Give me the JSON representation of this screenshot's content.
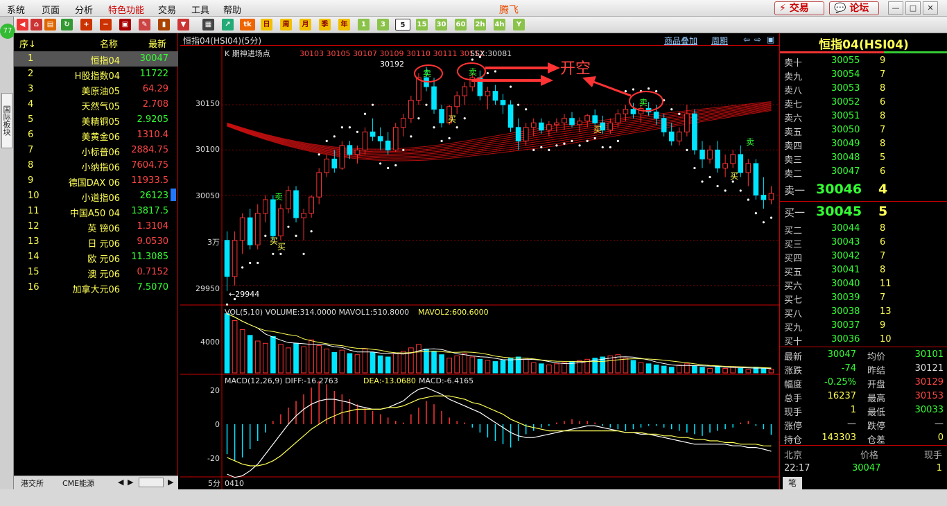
{
  "menu": {
    "items": [
      "系统",
      "页面",
      "分析",
      "特色功能",
      "交易",
      "工具",
      "帮助"
    ],
    "app_title": "腾飞",
    "trade_btn": "交易",
    "forum_btn": "论坛"
  },
  "toolbar": {
    "periods": [
      "日",
      "周",
      "月",
      "季",
      "年",
      "1",
      "3",
      "5",
      "15",
      "30",
      "60",
      "2h",
      "4h",
      "Y"
    ],
    "active_period": "5"
  },
  "left_strip": {
    "badge": "77",
    "vtab": "国际板块"
  },
  "watchlist": {
    "headers": {
      "index": "序↓",
      "name": "名称",
      "latest": "最新"
    },
    "rows": [
      {
        "idx": "1",
        "name": "恒指04",
        "price": "30047",
        "color": "#3f3",
        "selected": true
      },
      {
        "idx": "2",
        "name": "H股指数04",
        "price": "11722",
        "color": "#3f3"
      },
      {
        "idx": "3",
        "name": "美原油05",
        "price": "64.29",
        "color": "#f44"
      },
      {
        "idx": "4",
        "name": "天然气05",
        "price": "2.708",
        "color": "#f44"
      },
      {
        "idx": "5",
        "name": "美精铜05",
        "price": "2.9205",
        "color": "#3f3"
      },
      {
        "idx": "6",
        "name": "美黄金06",
        "price": "1310.4",
        "color": "#f44"
      },
      {
        "idx": "7",
        "name": "小标普06",
        "price": "2884.75",
        "color": "#f44"
      },
      {
        "idx": "8",
        "name": "小纳指06",
        "price": "7604.75",
        "color": "#f44"
      },
      {
        "idx": "9",
        "name": "德国DAX 06",
        "price": "11933.5",
        "color": "#f44"
      },
      {
        "idx": "10",
        "name": "小道指06",
        "price": "26123",
        "color": "#3f3"
      },
      {
        "idx": "11",
        "name": "中国A50 04",
        "price": "13817.5",
        "color": "#3f3"
      },
      {
        "idx": "12",
        "name": "英 镑06",
        "price": "1.3104",
        "color": "#f44"
      },
      {
        "idx": "13",
        "name": "日 元06",
        "price": "9.0530",
        "color": "#f44"
      },
      {
        "idx": "14",
        "name": "欧 元06",
        "price": "11.3085",
        "color": "#3f3"
      },
      {
        "idx": "15",
        "name": "澳 元06",
        "price": "0.7152",
        "color": "#f44"
      },
      {
        "idx": "16",
        "name": "加拿大元06",
        "price": "7.5070",
        "color": "#3f3"
      }
    ],
    "tabs": [
      "港交所",
      "CME能源"
    ]
  },
  "chart": {
    "header_title": "恒指04(HSI04)(5分)",
    "overlay_btn": "商品叠加",
    "period_btn": "周期",
    "kline_label": "K 期神进场点",
    "kline_values": "30103 30105 30107 30109 30110 30111 30112",
    "ssx": "SSX:30081",
    "high_mark": "30192",
    "low_mark": "←29944",
    "annotation": "开空",
    "sell_mark": "卖",
    "buy_mark": "买",
    "vol_label": "VOL(5,10) VOLUME:314.0000 MAVOL1:510.8000",
    "mavol2": "MAVOL2:600.6000",
    "macd_label": "MACD(12,26,9) DIFF:-16.2763",
    "dea": "DEA:-13.0680",
    "macd_val": "MACD:-6.4165",
    "price_axis": [
      "30150",
      "30100",
      "30050",
      "3万",
      "29950"
    ],
    "vol_axis": [
      "4000"
    ],
    "macd_axis": [
      "20",
      "0",
      "-20"
    ],
    "footer_period": "5分",
    "footer_date": "0410"
  },
  "chart_data": {
    "type": "candlestick",
    "ohlc": [
      [
        30000,
        30010,
        29944,
        29960
      ],
      [
        29960,
        30010,
        29950,
        30000
      ],
      [
        30000,
        30030,
        29985,
        30025
      ],
      [
        30025,
        30035,
        29990,
        29995
      ],
      [
        29995,
        30040,
        29990,
        30030
      ],
      [
        30030,
        30050,
        30020,
        30045
      ],
      [
        30045,
        30050,
        30000,
        30005
      ],
      [
        30005,
        30040,
        30000,
        30035
      ],
      [
        30035,
        30060,
        30030,
        30055
      ],
      [
        30055,
        30060,
        30020,
        30025
      ],
      [
        30025,
        30035,
        30000,
        30030
      ],
      [
        30030,
        30050,
        30025,
        30048
      ],
      [
        30048,
        30080,
        30040,
        30075
      ],
      [
        30075,
        30095,
        30070,
        30090
      ],
      [
        30090,
        30100,
        30075,
        30080
      ],
      [
        30080,
        30110,
        30078,
        30105
      ],
      [
        30105,
        30110,
        30090,
        30095
      ],
      [
        30095,
        30105,
        30085,
        30100
      ],
      [
        30100,
        30125,
        30095,
        30120
      ],
      [
        30120,
        30135,
        30110,
        30115
      ],
      [
        30115,
        30125,
        30100,
        30110
      ],
      [
        30110,
        30120,
        30095,
        30100
      ],
      [
        30100,
        30130,
        30098,
        30125
      ],
      [
        30125,
        30140,
        30115,
        30135
      ],
      [
        30135,
        30160,
        30130,
        30155
      ],
      [
        30155,
        30185,
        30150,
        30180
      ],
      [
        30180,
        30192,
        30165,
        30170
      ],
      [
        30170,
        30180,
        30140,
        30145
      ],
      [
        30145,
        30150,
        30125,
        30130
      ],
      [
        30130,
        30150,
        30128,
        30148
      ],
      [
        30148,
        30165,
        30140,
        30160
      ],
      [
        30160,
        30175,
        30150,
        30170
      ],
      [
        30170,
        30185,
        30165,
        30180
      ],
      [
        30180,
        30188,
        30155,
        30160
      ],
      [
        30160,
        30170,
        30145,
        30165
      ],
      [
        30165,
        30172,
        30150,
        30155
      ],
      [
        30155,
        30162,
        30140,
        30150
      ],
      [
        30150,
        30155,
        30120,
        30125
      ],
      [
        30125,
        30135,
        30100,
        30110
      ],
      [
        30110,
        30130,
        30105,
        30125
      ],
      [
        30125,
        30135,
        30115,
        30130
      ],
      [
        30130,
        30135,
        30118,
        30122
      ],
      [
        30122,
        30132,
        30115,
        30128
      ],
      [
        30128,
        30135,
        30120,
        30130
      ],
      [
        30130,
        30140,
        30122,
        30135
      ],
      [
        30135,
        30142,
        30125,
        30128
      ],
      [
        30128,
        30136,
        30120,
        30132
      ],
      [
        30132,
        30140,
        30125,
        30138
      ],
      [
        30138,
        30145,
        30128,
        30130
      ],
      [
        30130,
        30138,
        30118,
        30122
      ],
      [
        30122,
        30135,
        30118,
        30130
      ],
      [
        30130,
        30145,
        30125,
        30140
      ],
      [
        30140,
        30150,
        30132,
        30145
      ],
      [
        30145,
        30152,
        30135,
        30140
      ],
      [
        30140,
        30150,
        30130,
        30146
      ],
      [
        30146,
        30153,
        30138,
        30142
      ],
      [
        30142,
        30150,
        30128,
        30135
      ],
      [
        30135,
        30140,
        30115,
        30120
      ],
      [
        30120,
        30130,
        30105,
        30110
      ],
      [
        30110,
        30125,
        30105,
        30120
      ],
      [
        30120,
        30150,
        30115,
        30140
      ],
      [
        30140,
        30145,
        30095,
        30100
      ],
      [
        30100,
        30110,
        30080,
        30090
      ],
      [
        30090,
        30105,
        30085,
        30100
      ],
      [
        30100,
        30110,
        30075,
        30080
      ],
      [
        30080,
        30095,
        30070,
        30085
      ],
      [
        30085,
        30100,
        30080,
        30095
      ],
      [
        30095,
        30105,
        30070,
        30075
      ],
      [
        30075,
        30090,
        30060,
        30085
      ],
      [
        30085,
        30090,
        30045,
        30050
      ],
      [
        30050,
        30070,
        30035,
        30045
      ],
      [
        30045,
        30060,
        30040,
        30052
      ]
    ],
    "volume": [
      5200,
      4600,
      3800,
      3300,
      2800,
      2600,
      3200,
      2500,
      2200,
      2600,
      2300,
      2900,
      2400,
      2100,
      1800,
      2000,
      1700,
      1600,
      2100,
      1800,
      1500,
      1400,
      1700,
      1900,
      2200,
      2500,
      2100,
      1900,
      1600,
      1300,
      1500,
      1700,
      1400,
      1200,
      1100,
      1000,
      1100,
      1300,
      1400,
      1200,
      900,
      800,
      700,
      800,
      900,
      1000,
      1100,
      1200,
      1300,
      1400,
      1500,
      1600,
      1300,
      1100,
      900,
      800,
      700,
      600,
      500,
      700,
      800,
      600,
      500,
      400,
      600,
      400,
      500,
      400,
      300,
      500,
      400,
      314
    ],
    "macd_hist": [
      -18,
      -22,
      -20,
      -15,
      -10,
      -5,
      2,
      6,
      10,
      14,
      18,
      22,
      26,
      24,
      20,
      18,
      15,
      12,
      10,
      8,
      6,
      4,
      2,
      1,
      6,
      10,
      14,
      12,
      8,
      4,
      2,
      1,
      -2,
      -5,
      -8,
      -10,
      -12,
      -14,
      -10,
      -6,
      -4,
      -2,
      -1,
      1,
      2,
      3,
      2,
      2,
      1,
      -1,
      -2,
      -3,
      -4,
      -3,
      -2,
      -1,
      -1,
      -2,
      -3,
      -4,
      -5,
      -6,
      -7,
      -5,
      -4,
      -3,
      -2,
      1,
      2,
      -1,
      -3,
      -6.4
    ],
    "diff": [
      -30,
      -32,
      -31,
      -28,
      -24,
      -18,
      -12,
      -6,
      0,
      5,
      9,
      12,
      14,
      15,
      15,
      14,
      13,
      11,
      10,
      9,
      9,
      10,
      12,
      14,
      18,
      21,
      22,
      20,
      18,
      15,
      13,
      11,
      9,
      7,
      4,
      1,
      -2,
      -5,
      -7,
      -8,
      -8,
      -7,
      -6,
      -5,
      -4,
      -3,
      -2,
      -1,
      -1,
      -2,
      -3,
      -4,
      -5,
      -5,
      -6,
      -6,
      -7,
      -8,
      -9,
      -10,
      -11,
      -12,
      -12,
      -12,
      -12,
      -12,
      -13,
      -13,
      -14,
      -14,
      -15,
      -16.3
    ],
    "dea": [
      -20,
      -22,
      -24,
      -25,
      -25,
      -24,
      -22,
      -19,
      -15,
      -11,
      -7,
      -3,
      0,
      3,
      5,
      7,
      8,
      9,
      9,
      9,
      9,
      10,
      10,
      11,
      13,
      15,
      16,
      17,
      17,
      17,
      16,
      15,
      13,
      12,
      10,
      8,
      6,
      3,
      1,
      -1,
      -2,
      -3,
      -4,
      -4,
      -4,
      -4,
      -4,
      -4,
      -4,
      -4,
      -4,
      -4,
      -5,
      -5,
      -5,
      -6,
      -6,
      -7,
      -7,
      -8,
      -8,
      -9,
      -9,
      -10,
      -10,
      -11,
      -11,
      -12,
      -12,
      -12,
      -13,
      -13.1
    ],
    "ylim": [
      29930,
      30200
    ]
  },
  "quote": {
    "title": "恒指04(HSI04)",
    "asks": [
      {
        "label": "卖十",
        "price": "30055",
        "vol": "9"
      },
      {
        "label": "卖九",
        "price": "30054",
        "vol": "7"
      },
      {
        "label": "卖八",
        "price": "30053",
        "vol": "8"
      },
      {
        "label": "卖七",
        "price": "30052",
        "vol": "6"
      },
      {
        "label": "卖六",
        "price": "30051",
        "vol": "8"
      },
      {
        "label": "卖五",
        "price": "30050",
        "vol": "7"
      },
      {
        "label": "卖四",
        "price": "30049",
        "vol": "8"
      },
      {
        "label": "卖三",
        "price": "30048",
        "vol": "5"
      },
      {
        "label": "卖二",
        "price": "30047",
        "vol": "6"
      },
      {
        "label": "卖一",
        "price": "30046",
        "vol": "4"
      }
    ],
    "bids": [
      {
        "label": "买一",
        "price": "30045",
        "vol": "5"
      },
      {
        "label": "买二",
        "price": "30044",
        "vol": "8"
      },
      {
        "label": "买三",
        "price": "30043",
        "vol": "6"
      },
      {
        "label": "买四",
        "price": "30042",
        "vol": "7"
      },
      {
        "label": "买五",
        "price": "30041",
        "vol": "8"
      },
      {
        "label": "买六",
        "price": "30040",
        "vol": "11"
      },
      {
        "label": "买七",
        "price": "30039",
        "vol": "7"
      },
      {
        "label": "买八",
        "price": "30038",
        "vol": "13"
      },
      {
        "label": "买九",
        "price": "30037",
        "vol": "9"
      },
      {
        "label": "买十",
        "price": "30036",
        "vol": "10"
      }
    ],
    "stats": [
      {
        "l1": "最新",
        "v1": "30047",
        "c1": "#3f3",
        "l2": "均价",
        "v2": "30101",
        "c2": "#3f3"
      },
      {
        "l1": "涨跌",
        "v1": "-74",
        "c1": "#3f3",
        "l2": "昨结",
        "v2": "30121",
        "c2": "#ddd"
      },
      {
        "l1": "幅度",
        "v1": "-0.25%",
        "c1": "#3f3",
        "l2": "开盘",
        "v2": "30129",
        "c2": "#f44"
      },
      {
        "l1": "总手",
        "v1": "16237",
        "c1": "#ff5",
        "l2": "最高",
        "v2": "30153",
        "c2": "#f44"
      },
      {
        "l1": "现手",
        "v1": "1",
        "c1": "#ff5",
        "l2": "最低",
        "v2": "30033",
        "c2": "#3f3"
      },
      {
        "l1": "涨停",
        "v1": "—",
        "c1": "#ddd",
        "l2": "跌停",
        "v2": "—",
        "c2": "#ddd"
      },
      {
        "l1": "持仓",
        "v1": "143303",
        "c1": "#ff5",
        "l2": "仓差",
        "v2": "0",
        "c2": "#ff5"
      }
    ],
    "ticks_header": {
      "col1": "北京",
      "col2": "价格",
      "col3": "现手"
    },
    "tick": {
      "time": "22:17",
      "price": "30047",
      "vol": "1"
    },
    "bottom_tab": "笔"
  },
  "colors": {
    "up": "#ff3333",
    "down": "#00e5ff",
    "accent": "#c00000"
  }
}
